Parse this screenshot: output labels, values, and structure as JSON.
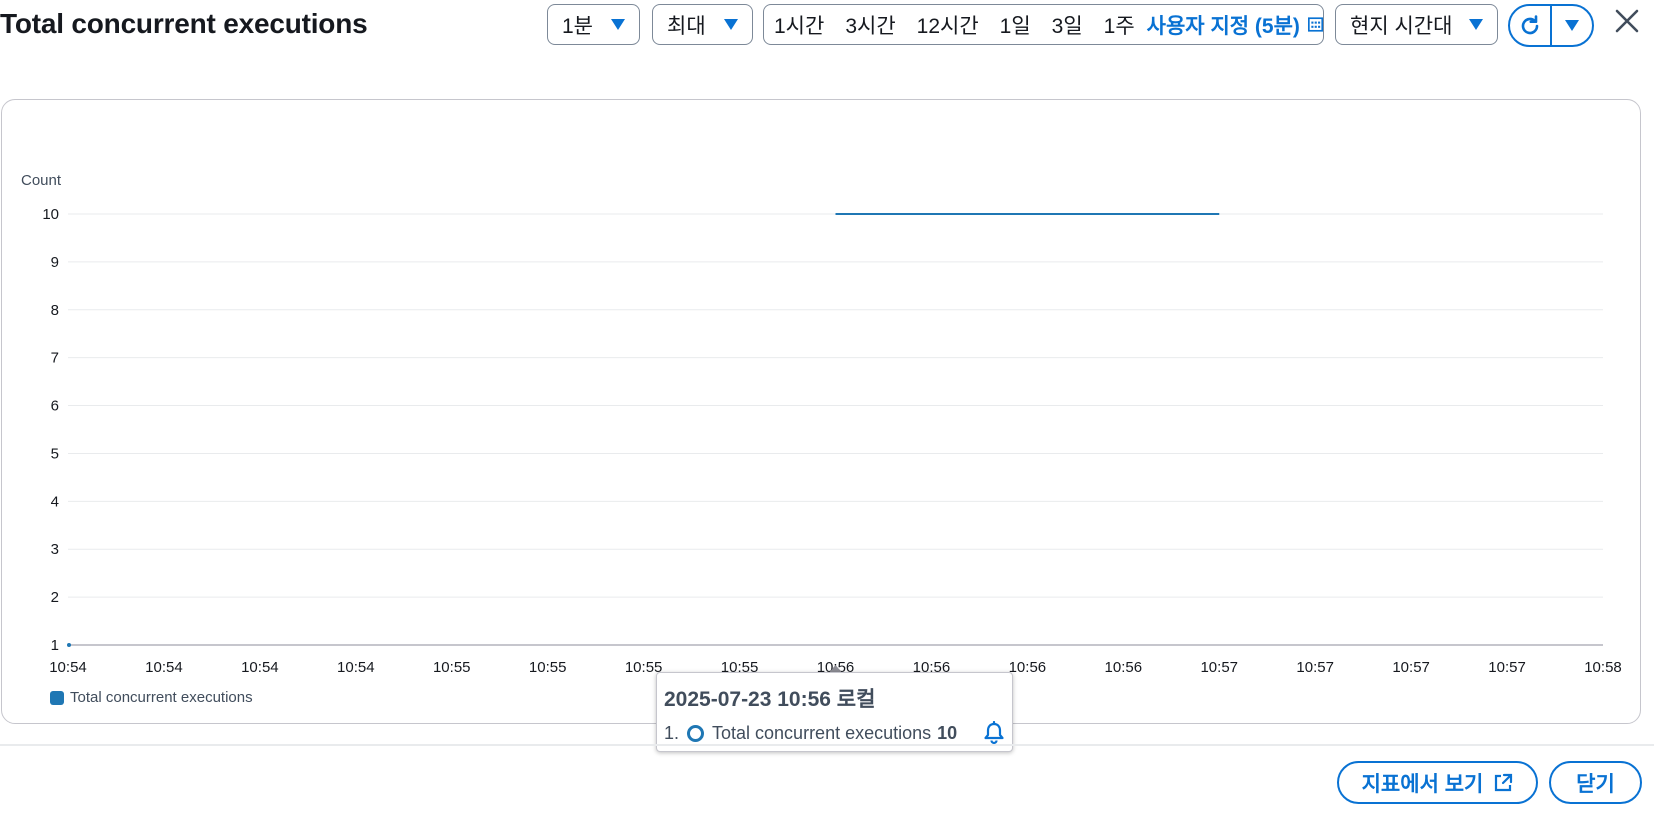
{
  "header": {
    "title": "Total concurrent executions",
    "period_value": "1분",
    "statistic_value": "최대",
    "time_range_options": [
      "1시간",
      "3시간",
      "12시간",
      "1일",
      "3일",
      "1주"
    ],
    "time_range_active": "사용자 지정 (5분)",
    "timezone_value": "현지 시간대"
  },
  "icons": {
    "dropdown": "caret-down-icon",
    "calendar": "calendar-icon",
    "refresh": "refresh-icon",
    "close": "close-icon",
    "bell": "bell-icon",
    "external": "external-link-icon"
  },
  "colors": {
    "accent": "#0972d3",
    "series": "#1f77b4"
  },
  "chart_data": {
    "type": "line",
    "ylabel": "Count",
    "ylim": [
      1,
      10
    ],
    "y_ticks": [
      "10",
      "9",
      "8",
      "7",
      "6",
      "5",
      "4",
      "3",
      "2",
      "1"
    ],
    "x_ticks": [
      "10:54",
      "10:54",
      "10:54",
      "10:54",
      "10:55",
      "10:55",
      "10:55",
      "10:55",
      "10:56",
      "10:56",
      "10:56",
      "10:56",
      "10:57",
      "10:57",
      "10:57",
      "10:57",
      "10:58"
    ],
    "series": [
      {
        "name": "Total concurrent executions",
        "color": "#1f77b4",
        "segments": [
          {
            "x_start": "10:56",
            "x_end": "10:57",
            "value": 10
          }
        ]
      }
    ],
    "legend": [
      "Total concurrent executions"
    ],
    "legend_position": "bottom-left",
    "grid": true
  },
  "tooltip": {
    "title": "2025-07-23 10:56 로컬",
    "index": "1.",
    "series_name": "Total concurrent executions",
    "value": "10"
  },
  "footer": {
    "view_in_metrics_label": "지표에서 보기",
    "close_label": "닫기"
  }
}
